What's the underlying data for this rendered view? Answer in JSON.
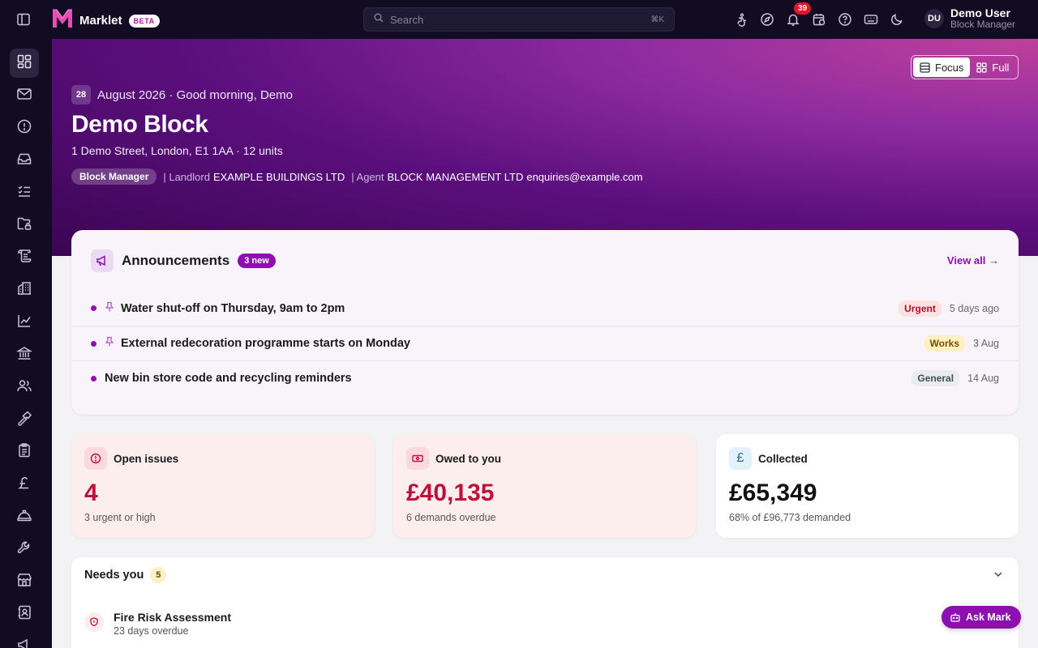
{
  "app": {
    "name": "Marklet",
    "badge": "BETA"
  },
  "search": {
    "placeholder": "Search",
    "shortcut": "⌘K"
  },
  "notifications": {
    "count": "39"
  },
  "user": {
    "initials": "DU",
    "name": "Demo User",
    "role": "Block Manager"
  },
  "view_toggle": {
    "focus_label": "Focus",
    "full_label": "Full",
    "selected": "Focus"
  },
  "hero": {
    "day": "28",
    "greeting": "August 2026 · Good morning, Demo",
    "title": "Demo Block",
    "address": "1 Demo Street, London, E1 1AA · 12 units",
    "role_chip": "Block Manager",
    "landlord_label": "| Landlord",
    "landlord_value": "EXAMPLE BUILDINGS LTD",
    "agent_label": "| Agent",
    "agent_value": "BLOCK MANAGEMENT LTD",
    "agent_email": "enquiries@example.com"
  },
  "announcements": {
    "title": "Announcements",
    "new_badge": "3 new",
    "view_all": "View all →",
    "items": [
      {
        "text": "Water shut-off on Thursday, 9am to 2pm",
        "tag": "Urgent",
        "date": "5 days ago",
        "pinned": true
      },
      {
        "text": "External redecoration programme starts on Monday",
        "tag": "Works",
        "date": "3 Aug",
        "pinned": true
      },
      {
        "text": "New bin store code and recycling reminders",
        "tag": "General",
        "date": "14 Aug",
        "pinned": false
      }
    ]
  },
  "stats": [
    {
      "label": "Open issues",
      "value": "4",
      "sub": "3 urgent or high"
    },
    {
      "label": "Owed to you",
      "value": "£40,135",
      "sub": "6 demands overdue"
    },
    {
      "label": "Collected",
      "value": "£65,349",
      "sub": "68% of £96,773 demanded",
      "icon_char": "£"
    }
  ],
  "needs_you": {
    "title": "Needs you",
    "count": "5",
    "items": [
      {
        "title": "Fire Risk Assessment",
        "sub": "23 days overdue"
      }
    ]
  },
  "ask_mark": "Ask Mark",
  "colors": {
    "accent": "#8d0fb0",
    "danger": "#c0103a",
    "topbar": "#110c22"
  }
}
